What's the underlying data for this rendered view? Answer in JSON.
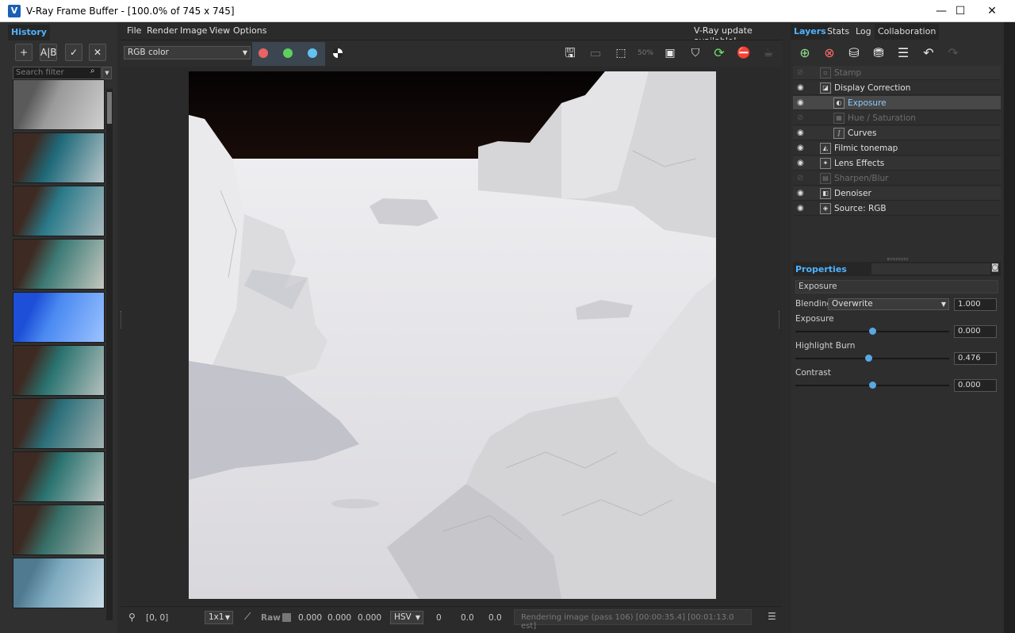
{
  "window": {
    "title": "V-Ray Frame Buffer - [100.0% of 745 x 745]",
    "minimize": "—",
    "maximize": "☐",
    "close": "✕"
  },
  "history": {
    "tab": "History",
    "search_placeholder": "Search filter",
    "thumbnails": [
      {
        "name": "history-thumb-1",
        "colors": [
          "#5a5a5a",
          "#9a9a9a",
          "#cfcfcf"
        ]
      },
      {
        "name": "history-thumb-2",
        "colors": [
          "#3d2a22",
          "#1f6a7a",
          "#b8c5c9"
        ]
      },
      {
        "name": "history-thumb-3",
        "colors": [
          "#3d2a22",
          "#2a7a8a",
          "#a9b9bc"
        ]
      },
      {
        "name": "history-thumb-4",
        "colors": [
          "#3d2a22",
          "#3d7a76",
          "#c4c8bf"
        ]
      },
      {
        "name": "history-thumb-5",
        "colors": [
          "#1d4fd8",
          "#4b8af2",
          "#9cc3ff"
        ]
      },
      {
        "name": "history-thumb-6",
        "colors": [
          "#3d2a22",
          "#2a7370",
          "#b5c0bd"
        ]
      },
      {
        "name": "history-thumb-7",
        "colors": [
          "#3d2a22",
          "#2b6f7a",
          "#a4b2b0"
        ]
      },
      {
        "name": "history-thumb-8",
        "colors": [
          "#3d2a22",
          "#2a7370",
          "#b9c4c0"
        ]
      },
      {
        "name": "history-thumb-9",
        "colors": [
          "#3d2a22",
          "#37716a",
          "#a7b4ae"
        ]
      },
      {
        "name": "history-thumb-10",
        "colors": [
          "#4f7a8f",
          "#7eaac0",
          "#c9dde6"
        ]
      }
    ]
  },
  "menubar": {
    "items": [
      "File",
      "Render",
      "Image",
      "View",
      "Options"
    ],
    "update_notice": "V-Ray update available!"
  },
  "toolbar": {
    "channel": "RGB color",
    "channel_colors": {
      "red": "#e86464",
      "green": "#5dd05d",
      "blue": "#62c2f0"
    }
  },
  "statusbar": {
    "coords": "[0, 0]",
    "sampling": "1x1",
    "raw_label": "Raw",
    "raw_values": [
      "0.000",
      "0.000",
      "0.000"
    ],
    "color_mode": "HSV",
    "hsv_values": [
      "0",
      "0.0",
      "0.0"
    ],
    "status": "Rendering image (pass 106) [00:00:35.4] [00:01:13.0 est]"
  },
  "layers_panel": {
    "tabs": [
      "Layers",
      "Stats",
      "Log",
      "Collaboration"
    ],
    "layers": [
      {
        "name": "Stamp",
        "enabled": false,
        "indent": 0
      },
      {
        "name": "Display Correction",
        "enabled": true,
        "indent": 0
      },
      {
        "name": "Exposure",
        "enabled": true,
        "indent": 1,
        "selected": true
      },
      {
        "name": "Hue / Saturation",
        "enabled": false,
        "indent": 1
      },
      {
        "name": "Curves",
        "enabled": true,
        "indent": 1
      },
      {
        "name": "Filmic tonemap",
        "enabled": true,
        "indent": 0
      },
      {
        "name": "Lens Effects",
        "enabled": true,
        "indent": 0
      },
      {
        "name": "Sharpen/Blur",
        "enabled": false,
        "indent": 0
      },
      {
        "name": "Denoiser",
        "enabled": true,
        "indent": 0
      },
      {
        "name": "Source: RGB",
        "enabled": true,
        "indent": 0
      }
    ]
  },
  "properties": {
    "header": "Properties",
    "layer_name": "Exposure",
    "blending_label": "Blending",
    "blending_mode": "Overwrite",
    "blending_value": "1.000",
    "sliders": [
      {
        "label": "Exposure",
        "value": "0.000",
        "position": 0.5
      },
      {
        "label": "Highlight Burn",
        "value": "0.476",
        "position": 0.476
      },
      {
        "label": "Contrast",
        "value": "0.000",
        "position": 0.5
      }
    ]
  }
}
